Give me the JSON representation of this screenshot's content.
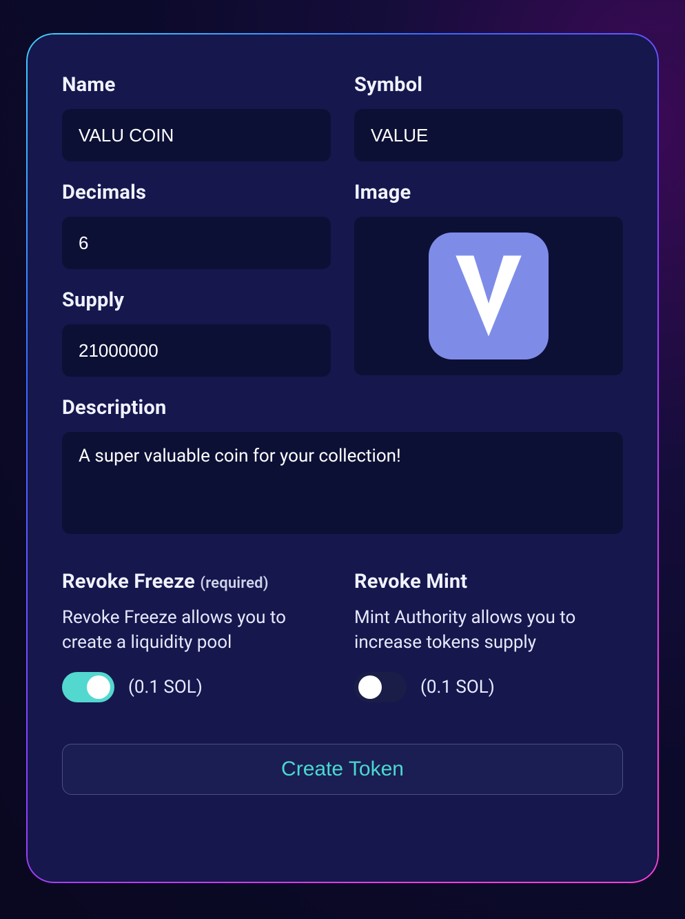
{
  "form": {
    "name": {
      "label": "Name",
      "value": "VALU COIN"
    },
    "symbol": {
      "label": "Symbol",
      "value": "VALUE"
    },
    "decimals": {
      "label": "Decimals",
      "value": "6"
    },
    "supply": {
      "label": "Supply",
      "value": "21000000"
    },
    "image": {
      "label": "Image",
      "token_letter": "V",
      "tile_color": "#7e8ce8"
    },
    "description": {
      "label": "Description",
      "value": "A super valuable coin for your collection!"
    }
  },
  "options": {
    "revoke_freeze": {
      "title": "Revoke Freeze",
      "required_tag": "(required)",
      "desc": "Revoke Freeze allows you to create a liquidity pool",
      "cost": "(0.1 SOL)",
      "on": true
    },
    "revoke_mint": {
      "title": "Revoke Mint",
      "desc": "Mint Authority allows you to increase tokens supply",
      "cost": "(0.1 SOL)",
      "on": false
    }
  },
  "actions": {
    "create": "Create Token"
  },
  "colors": {
    "panel_bg": "#16174d",
    "input_bg": "#0d1035",
    "accent_teal": "#53d8cf",
    "button_text": "#49d9d1"
  }
}
